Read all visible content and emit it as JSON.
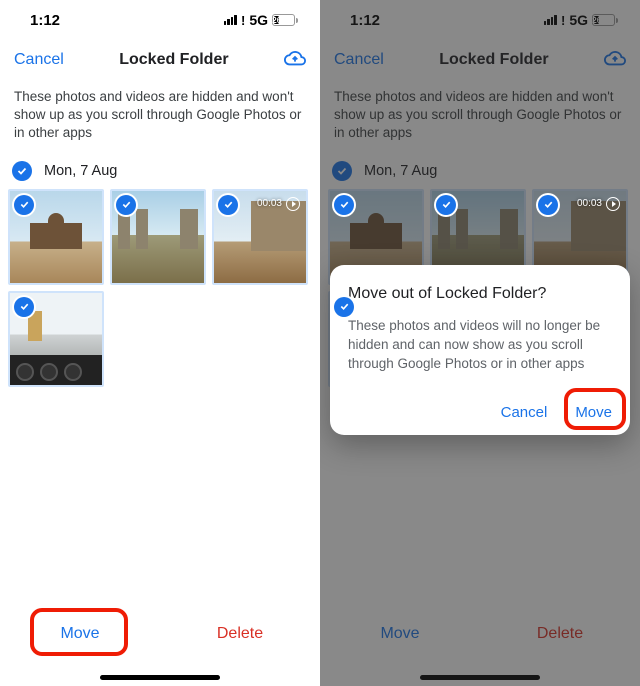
{
  "status": {
    "time": "1:12",
    "network": "5G",
    "battery_pct": "26"
  },
  "header": {
    "cancel": "Cancel",
    "title": "Locked Folder"
  },
  "info": "These photos and videos are hidden and won't show up as you scroll through Google Photos or in other apps",
  "date_label": "Mon, 7 Aug",
  "video_duration": "00:03",
  "bottom": {
    "move": "Move",
    "delete": "Delete"
  },
  "dialog": {
    "title": "Move out of Locked Folder?",
    "body": "These photos and videos will no longer be hidden and can now show as you scroll through Google Photos or in other apps",
    "cancel": "Cancel",
    "confirm": "Move"
  }
}
